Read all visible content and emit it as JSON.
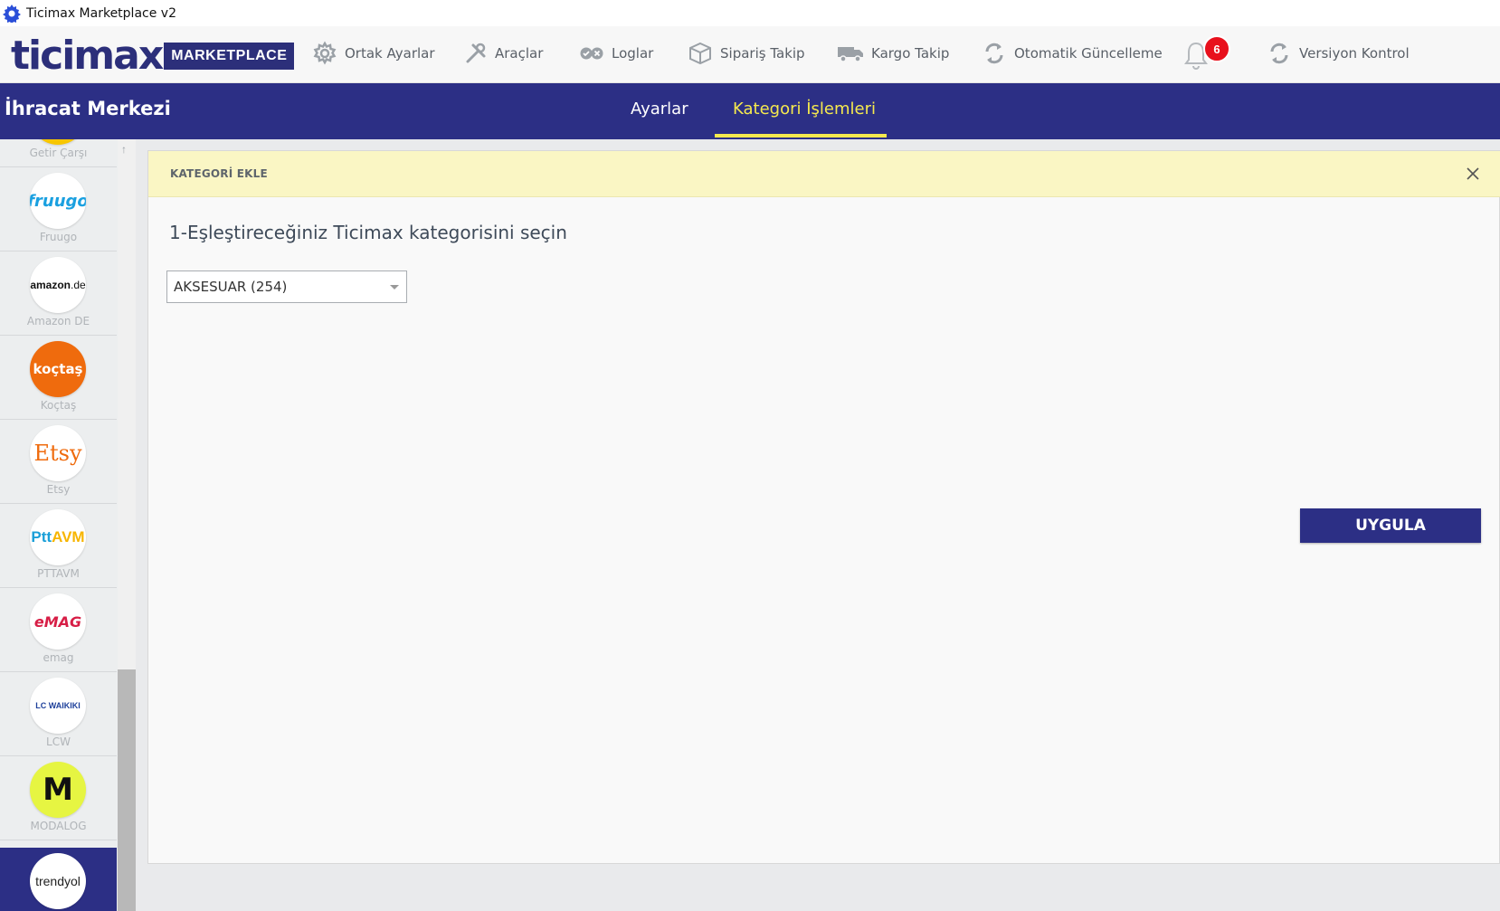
{
  "window": {
    "title": "Ticimax Marketplace v2",
    "icon": "gear-icon",
    "icon_color": "#2b4fd8"
  },
  "toolbar": {
    "logo_text": "ticimax",
    "logo_badge": "MARKETPLACE",
    "items": [
      {
        "label": "Ortak Ayarlar",
        "icon": "gear-icon"
      },
      {
        "label": "Araçlar",
        "icon": "tools-icon"
      },
      {
        "label": "Loglar",
        "icon": "log-toggle-icon"
      },
      {
        "label": "Sipariş Takip",
        "icon": "package-icon"
      },
      {
        "label": "Kargo Takip",
        "icon": "truck-icon"
      },
      {
        "label": "Otomatik Güncelleme",
        "icon": "sync-icon"
      },
      {
        "label": "Versiyon Kontrol",
        "icon": "sync-icon"
      }
    ],
    "notifications": {
      "icon": "bell-icon",
      "count": "6",
      "badge_color": "#e8101c"
    }
  },
  "header": {
    "title": "İhracat Merkezi",
    "tabs": [
      {
        "label": "Ayarlar",
        "active": false
      },
      {
        "label": "Kategori İşlemleri",
        "active": true
      }
    ],
    "bg_color": "#2c2f85",
    "active_color": "#f5e94e"
  },
  "sidebar": {
    "items": [
      {
        "name": "Getir Çarşı",
        "logo": "getir-logo"
      },
      {
        "name": "Fruugo",
        "logo": "fruugo-logo"
      },
      {
        "name": "Amazon DE",
        "logo": "amazon-de-logo"
      },
      {
        "name": "Koçtaş",
        "logo": "koctas-logo"
      },
      {
        "name": "Etsy",
        "logo": "etsy-logo"
      },
      {
        "name": "PTTAVM",
        "logo": "pttavm-logo"
      },
      {
        "name": "emag",
        "logo": "emag-logo"
      },
      {
        "name": "LCW",
        "logo": "lcw-logo"
      },
      {
        "name": "MODALOG",
        "logo": "modalog-logo"
      },
      {
        "name": "",
        "logo": "trendyol-logo",
        "active": true
      }
    ],
    "logo_texts": {
      "fruugo": "fruugo",
      "amazon": "amazon",
      "amazon_suffix": ".de",
      "koctas": "koçtaş",
      "etsy": "Etsy",
      "ptt": "Ptt",
      "avm": "AVM",
      "emag": "eMAG",
      "lcw": "LC WAIKIKI",
      "modalog": "M",
      "trendyol": "trendyol"
    }
  },
  "panel": {
    "header_title": "KATEGORİ EKLE",
    "step_title": "1-Eşleştireceğiniz Ticimax kategorisini seçin",
    "category_select": {
      "value": "AKSESUAR (254)"
    },
    "apply_label": "UYGULA",
    "header_bg": "#faf6c4"
  }
}
